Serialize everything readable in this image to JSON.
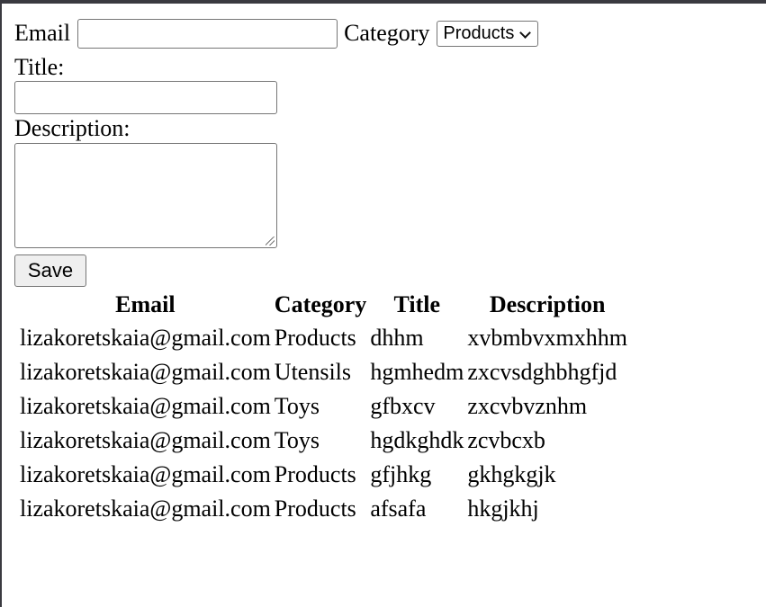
{
  "form": {
    "email_label": "Email",
    "email_value": "",
    "category_label": "Category",
    "category_selected": "Products",
    "title_label": "Title:",
    "title_value": "",
    "description_label": "Description:",
    "description_value": "",
    "save_label": "Save"
  },
  "table": {
    "headers": {
      "email": "Email",
      "category": "Category",
      "title": "Title",
      "description": "Description"
    },
    "rows": [
      {
        "email": "lizakoretskaia@gmail.com",
        "category": "Products",
        "title": "dhhm",
        "description": "xvbmbvxmxhhm"
      },
      {
        "email": "lizakoretskaia@gmail.com",
        "category": "Utensils",
        "title": "hgmhedm",
        "description": "zxcvsdghbhgfjd"
      },
      {
        "email": "lizakoretskaia@gmail.com",
        "category": "Toys",
        "title": "gfbxcv",
        "description": "zxcvbvznhm"
      },
      {
        "email": "lizakoretskaia@gmail.com",
        "category": "Toys",
        "title": "hgdkghdk",
        "description": "zcvbcxb"
      },
      {
        "email": "lizakoretskaia@gmail.com",
        "category": "Products",
        "title": "gfjhkg",
        "description": "gkhgkgjk"
      },
      {
        "email": "lizakoretskaia@gmail.com",
        "category": "Products",
        "title": "afsafa",
        "description": "hkgjkhj"
      }
    ]
  },
  "icons": {
    "select_arrow": "chevron-down-icon",
    "textarea_resize": "resize-grip-icon"
  },
  "colors": {
    "window_border": "#3a3a40",
    "control_border": "#767676",
    "button_background": "#efefef"
  }
}
